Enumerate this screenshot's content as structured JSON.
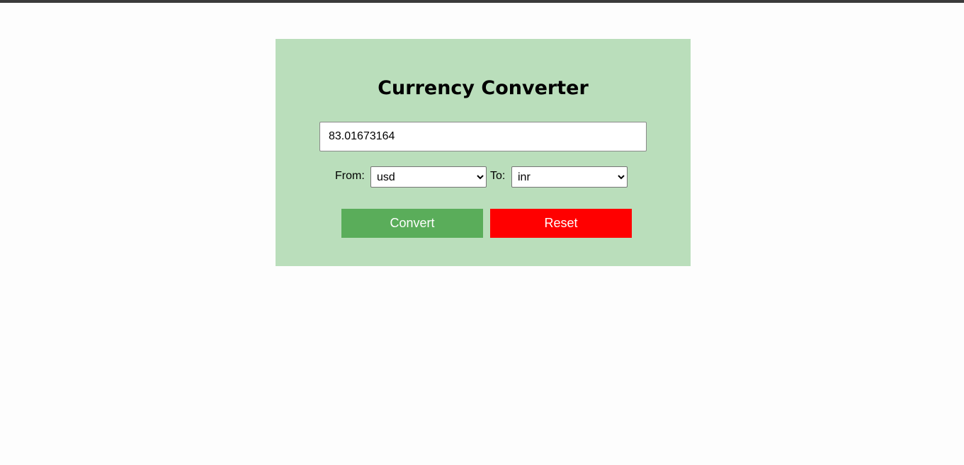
{
  "converter": {
    "title": "Currency Converter",
    "amount_value": "83.01673164",
    "from_label": "From:",
    "to_label": "To:",
    "from_options": [
      "usd"
    ],
    "from_selected": "usd",
    "to_options": [
      "inr"
    ],
    "to_selected": "inr",
    "convert_label": "Convert",
    "reset_label": "Reset"
  },
  "colors": {
    "card_background": "#badebb",
    "convert_button": "#5aad5a",
    "reset_button": "#ff0000",
    "top_bar": "#3b3b3b"
  }
}
